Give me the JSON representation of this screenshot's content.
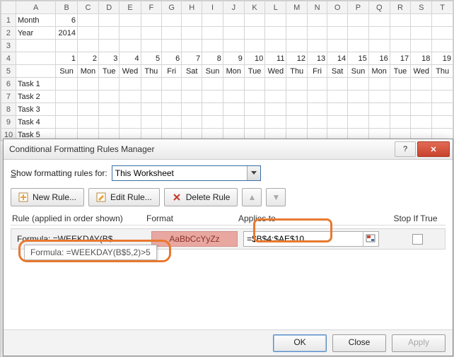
{
  "sheet": {
    "col_headers": [
      "A",
      "B",
      "C",
      "D",
      "E",
      "F",
      "G",
      "H",
      "I",
      "J",
      "K",
      "L",
      "M",
      "N",
      "O",
      "P",
      "Q",
      "R",
      "S",
      "T"
    ],
    "rows": {
      "r1": {
        "A": "Month",
        "B": "6"
      },
      "r2": {
        "A": "Year",
        "B": "2014"
      },
      "r4_days": [
        "1",
        "2",
        "3",
        "4",
        "5",
        "6",
        "7",
        "8",
        "9",
        "10",
        "11",
        "12",
        "13",
        "14",
        "15",
        "16",
        "17",
        "18",
        "19"
      ],
      "r5_dow": [
        "Sun",
        "Mon",
        "Tue",
        "Wed",
        "Thu",
        "Fri",
        "Sat",
        "Sun",
        "Mon",
        "Tue",
        "Wed",
        "Thu",
        "Fri",
        "Sat",
        "Sun",
        "Mon",
        "Tue",
        "Wed",
        "Thu"
      ],
      "tasks": [
        "Task 1",
        "Task 2",
        "Task 3",
        "Task 4",
        "Task 5"
      ]
    },
    "weekend_cols": [
      0,
      6,
      7,
      13,
      14
    ]
  },
  "dialog": {
    "title": "Conditional Formatting Rules Manager",
    "help_symbol": "?",
    "close_symbol": "✕",
    "show_label_pre": "S",
    "show_label": "how formatting rules for:",
    "scope_value": "This Worksheet",
    "buttons": {
      "new": "New Rule...",
      "edit": "Edit Rule...",
      "delete": "Delete Rule",
      "up": "▲",
      "down": "▼"
    },
    "headers": {
      "rule": "Rule (applied in order shown)",
      "format": "Format",
      "applies": "Applies to",
      "stop": "Stop If True"
    },
    "rule": {
      "text": "Formula: =WEEKDAY(B$...",
      "preview": "AaBbCcYyZz",
      "applies_to": "=$B$4:$AE$10"
    },
    "tooltip": "Formula: =WEEKDAY(B$5,2)>5",
    "footer": {
      "ok": "OK",
      "close": "Close",
      "apply": "Apply"
    }
  }
}
